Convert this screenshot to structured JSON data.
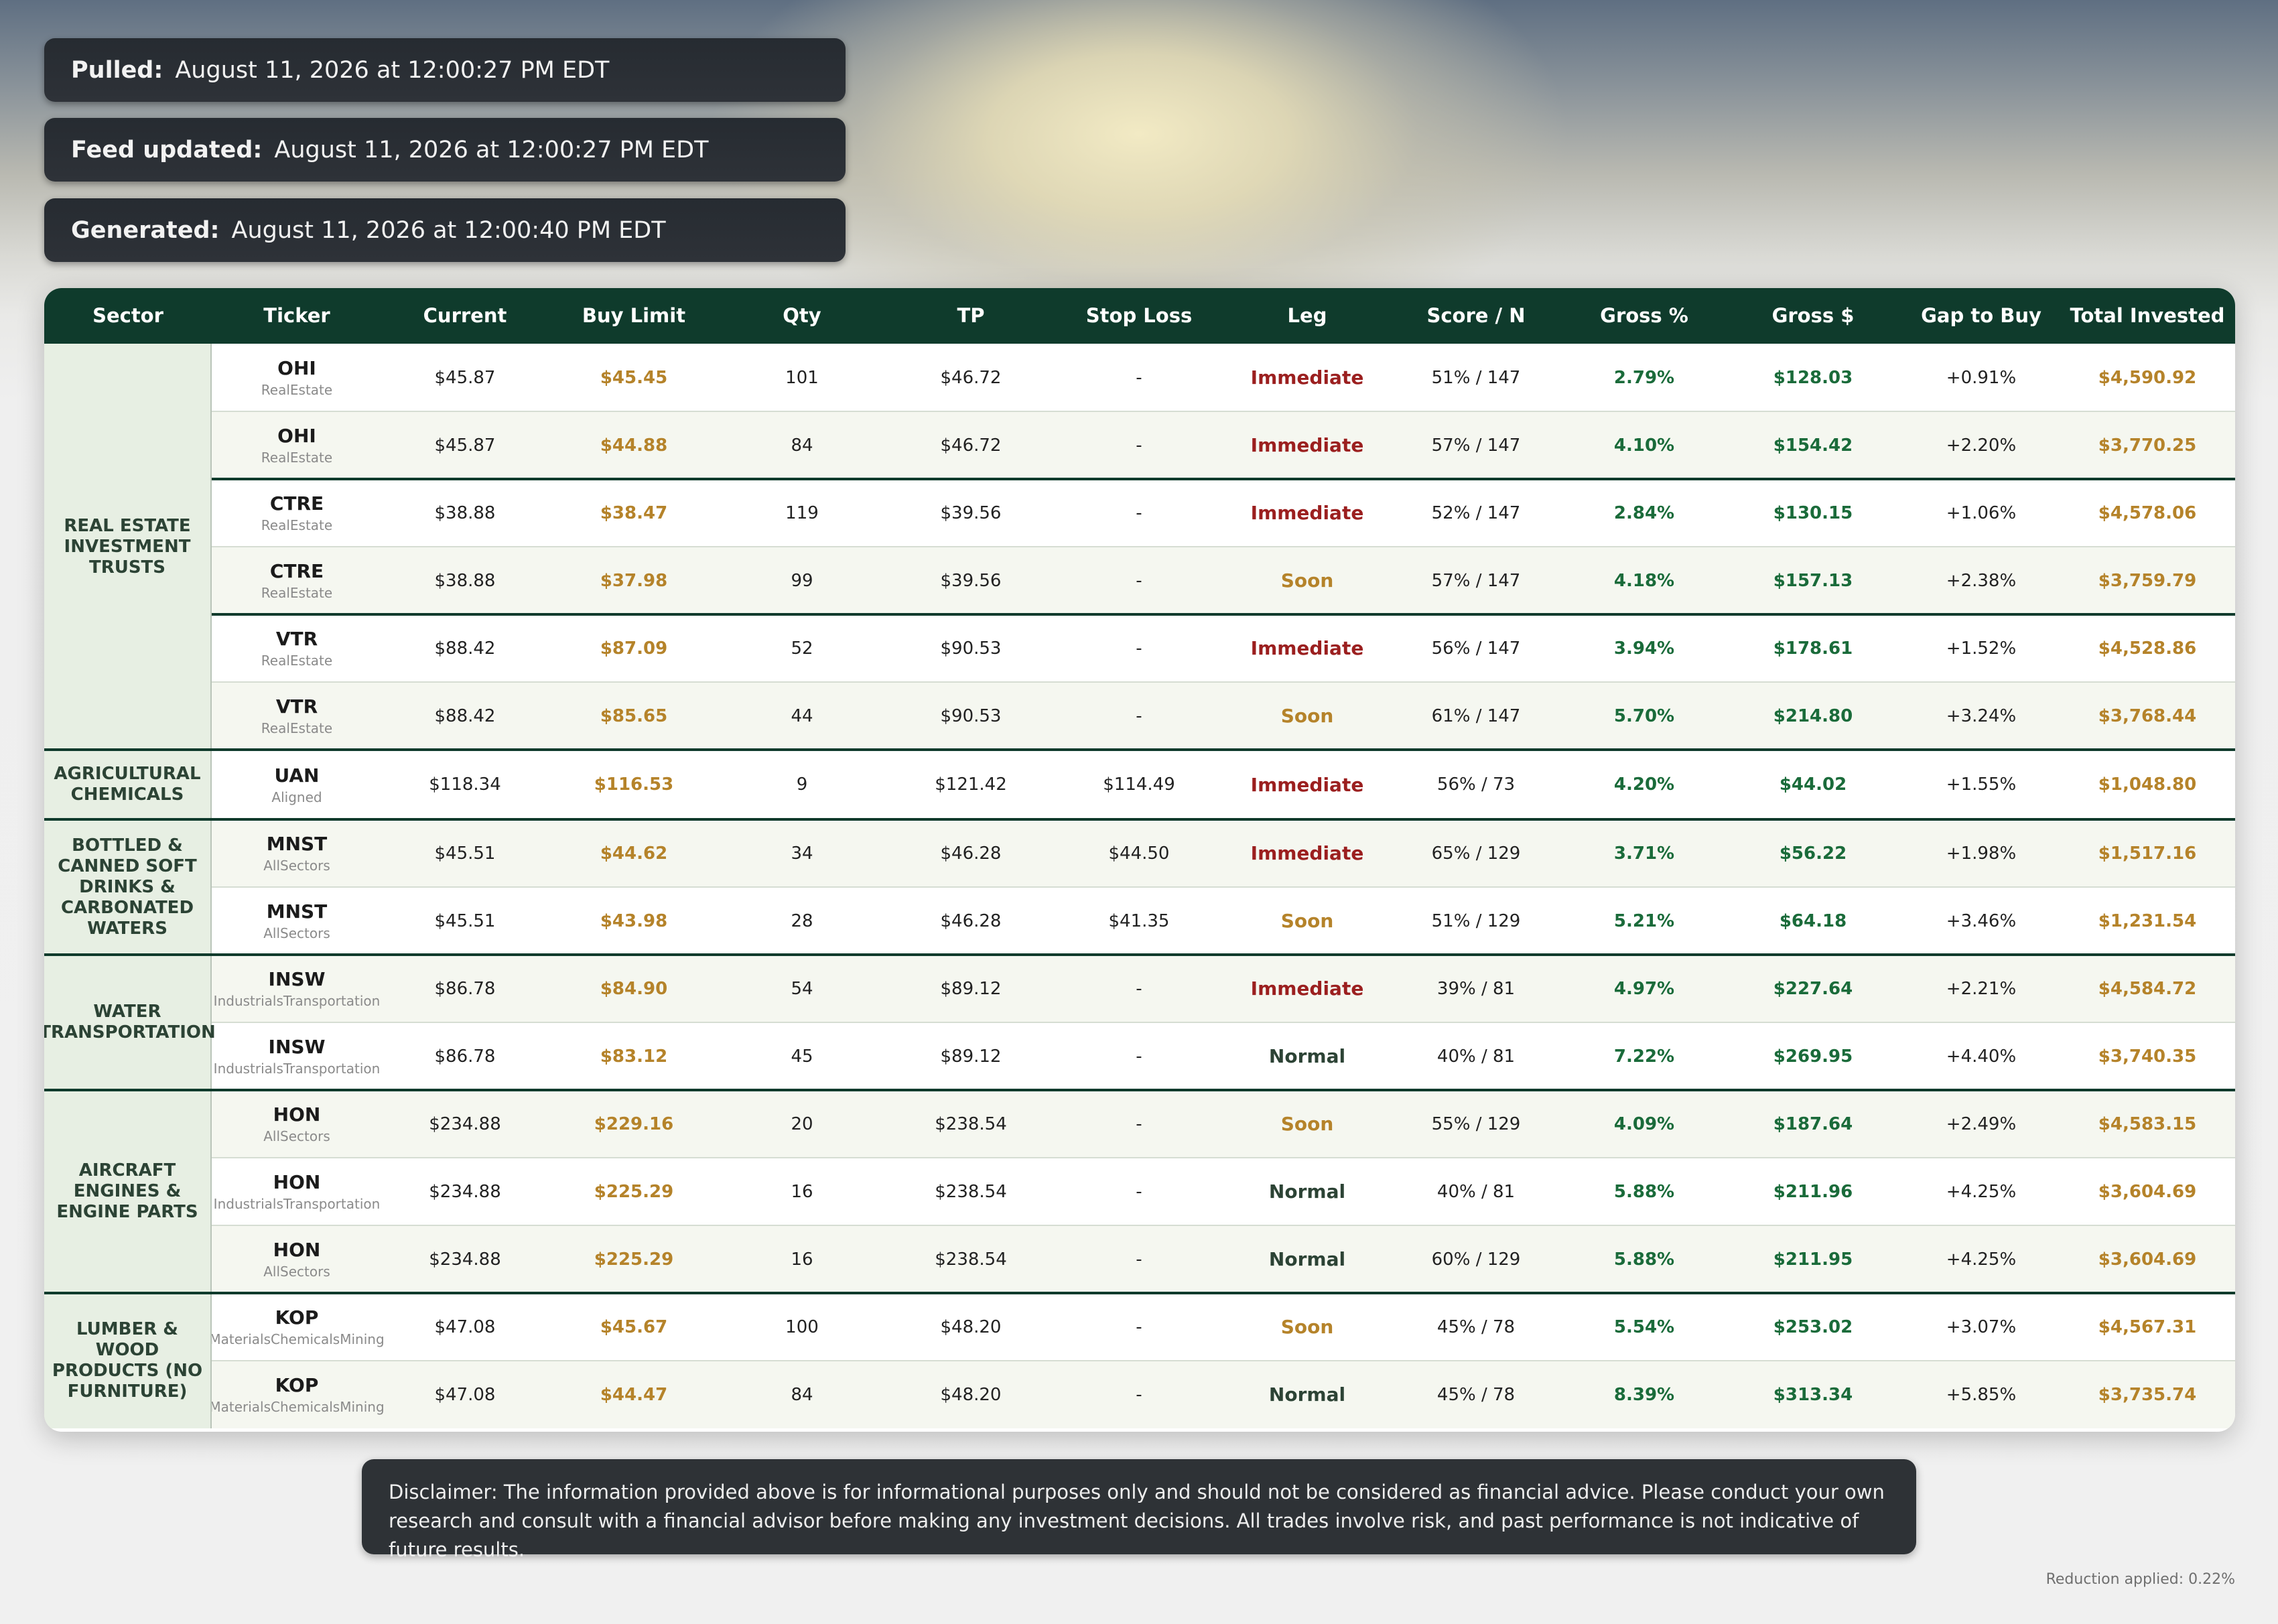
{
  "timestamps": [
    {
      "label": "Pulled:",
      "value": "August 11, 2026 at 12:00:27 PM EDT"
    },
    {
      "label": "Feed updated:",
      "value": "August 11, 2026 at 12:00:27 PM EDT"
    },
    {
      "label": "Generated:",
      "value": "August 11, 2026 at 12:00:40 PM EDT"
    }
  ],
  "table": {
    "headers": [
      "Sector",
      "Ticker",
      "Current",
      "Buy Limit",
      "Qty",
      "TP",
      "Stop Loss",
      "Leg",
      "Score / N",
      "Gross %",
      "Gross $",
      "Gap to Buy",
      "Total Invested"
    ],
    "sectors": [
      {
        "name": "REAL ESTATE INVESTMENT TRUSTS",
        "display": "REAL ESTATE\nINVESTMENT\nTRUSTS",
        "rows": 6
      },
      {
        "name": "AGRICULTURAL CHEMICALS",
        "display": "AGRICULTURAL\nCHEMICALS",
        "rows": 1
      },
      {
        "name": "BOTTLED & CANNED SOFT DRINKS & CARBONATED WATERS",
        "display": "BOTTLED &\nCANNED SOFT\nDRINKS &\nCARBONATED\nWATERS",
        "rows": 2
      },
      {
        "name": "WATER TRANSPORTATION",
        "display": "WATER\nTRANSPORTATION",
        "rows": 2
      },
      {
        "name": "AIRCRAFT ENGINES & ENGINE PARTS",
        "display": "AIRCRAFT\nENGINES &\nENGINE PARTS",
        "rows": 3
      },
      {
        "name": "LUMBER & WOOD PRODUCTS (NO FURNITURE)",
        "display": "LUMBER &\nWOOD\nPRODUCTS (NO\nFURNITURE)",
        "rows": 2
      }
    ],
    "rows": [
      {
        "ticker": "OHI",
        "source": "RealEstate",
        "current": "$45.87",
        "buy_limit": "$45.45",
        "qty": "101",
        "tp": "$46.72",
        "stop_loss": "-",
        "leg": "Immediate",
        "score": "51% / 147",
        "gross_pct": "2.79%",
        "gross_usd": "$128.03",
        "gap": "+0.91%",
        "total": "$4,590.92"
      },
      {
        "ticker": "OHI",
        "source": "RealEstate",
        "current": "$45.87",
        "buy_limit": "$44.88",
        "qty": "84",
        "tp": "$46.72",
        "stop_loss": "-",
        "leg": "Immediate",
        "score": "57% / 147",
        "gross_pct": "4.10%",
        "gross_usd": "$154.42",
        "gap": "+2.20%",
        "total": "$3,770.25"
      },
      {
        "ticker": "CTRE",
        "source": "RealEstate",
        "current": "$38.88",
        "buy_limit": "$38.47",
        "qty": "119",
        "tp": "$39.56",
        "stop_loss": "-",
        "leg": "Immediate",
        "score": "52% / 147",
        "gross_pct": "2.84%",
        "gross_usd": "$130.15",
        "gap": "+1.06%",
        "total": "$4,578.06"
      },
      {
        "ticker": "CTRE",
        "source": "RealEstate",
        "current": "$38.88",
        "buy_limit": "$37.98",
        "qty": "99",
        "tp": "$39.56",
        "stop_loss": "-",
        "leg": "Soon",
        "score": "57% / 147",
        "gross_pct": "4.18%",
        "gross_usd": "$157.13",
        "gap": "+2.38%",
        "total": "$3,759.79"
      },
      {
        "ticker": "VTR",
        "source": "RealEstate",
        "current": "$88.42",
        "buy_limit": "$87.09",
        "qty": "52",
        "tp": "$90.53",
        "stop_loss": "-",
        "leg": "Immediate",
        "score": "56% / 147",
        "gross_pct": "3.94%",
        "gross_usd": "$178.61",
        "gap": "+1.52%",
        "total": "$4,528.86"
      },
      {
        "ticker": "VTR",
        "source": "RealEstate",
        "current": "$88.42",
        "buy_limit": "$85.65",
        "qty": "44",
        "tp": "$90.53",
        "stop_loss": "-",
        "leg": "Soon",
        "score": "61% / 147",
        "gross_pct": "5.70%",
        "gross_usd": "$214.80",
        "gap": "+3.24%",
        "total": "$3,768.44"
      },
      {
        "ticker": "UAN",
        "source": "Aligned",
        "current": "$118.34",
        "buy_limit": "$116.53",
        "qty": "9",
        "tp": "$121.42",
        "stop_loss": "$114.49",
        "leg": "Immediate",
        "score": "56% / 73",
        "gross_pct": "4.20%",
        "gross_usd": "$44.02",
        "gap": "+1.55%",
        "total": "$1,048.80"
      },
      {
        "ticker": "MNST",
        "source": "AllSectors",
        "current": "$45.51",
        "buy_limit": "$44.62",
        "qty": "34",
        "tp": "$46.28",
        "stop_loss": "$44.50",
        "leg": "Immediate",
        "score": "65% / 129",
        "gross_pct": "3.71%",
        "gross_usd": "$56.22",
        "gap": "+1.98%",
        "total": "$1,517.16"
      },
      {
        "ticker": "MNST",
        "source": "AllSectors",
        "current": "$45.51",
        "buy_limit": "$43.98",
        "qty": "28",
        "tp": "$46.28",
        "stop_loss": "$41.35",
        "leg": "Soon",
        "score": "51% / 129",
        "gross_pct": "5.21%",
        "gross_usd": "$64.18",
        "gap": "+3.46%",
        "total": "$1,231.54"
      },
      {
        "ticker": "INSW",
        "source": "IndustrialsTransportation",
        "current": "$86.78",
        "buy_limit": "$84.90",
        "qty": "54",
        "tp": "$89.12",
        "stop_loss": "-",
        "leg": "Immediate",
        "score": "39% / 81",
        "gross_pct": "4.97%",
        "gross_usd": "$227.64",
        "gap": "+2.21%",
        "total": "$4,584.72"
      },
      {
        "ticker": "INSW",
        "source": "IndustrialsTransportation",
        "current": "$86.78",
        "buy_limit": "$83.12",
        "qty": "45",
        "tp": "$89.12",
        "stop_loss": "-",
        "leg": "Normal",
        "score": "40% / 81",
        "gross_pct": "7.22%",
        "gross_usd": "$269.95",
        "gap": "+4.40%",
        "total": "$3,740.35"
      },
      {
        "ticker": "HON",
        "source": "AllSectors",
        "current": "$234.88",
        "buy_limit": "$229.16",
        "qty": "20",
        "tp": "$238.54",
        "stop_loss": "-",
        "leg": "Soon",
        "score": "55% / 129",
        "gross_pct": "4.09%",
        "gross_usd": "$187.64",
        "gap": "+2.49%",
        "total": "$4,583.15"
      },
      {
        "ticker": "HON",
        "source": "IndustrialsTransportation",
        "current": "$234.88",
        "buy_limit": "$225.29",
        "qty": "16",
        "tp": "$238.54",
        "stop_loss": "-",
        "leg": "Normal",
        "score": "40% / 81",
        "gross_pct": "5.88%",
        "gross_usd": "$211.96",
        "gap": "+4.25%",
        "total": "$3,604.69"
      },
      {
        "ticker": "HON",
        "source": "AllSectors",
        "current": "$234.88",
        "buy_limit": "$225.29",
        "qty": "16",
        "tp": "$238.54",
        "stop_loss": "-",
        "leg": "Normal",
        "score": "60% / 129",
        "gross_pct": "5.88%",
        "gross_usd": "$211.95",
        "gap": "+4.25%",
        "total": "$3,604.69"
      },
      {
        "ticker": "KOP",
        "source": "MaterialsChemicalsMining",
        "current": "$47.08",
        "buy_limit": "$45.67",
        "qty": "100",
        "tp": "$48.20",
        "stop_loss": "-",
        "leg": "Soon",
        "score": "45% / 78",
        "gross_pct": "5.54%",
        "gross_usd": "$253.02",
        "gap": "+3.07%",
        "total": "$4,567.31"
      },
      {
        "ticker": "KOP",
        "source": "MaterialsChemicalsMining",
        "current": "$47.08",
        "buy_limit": "$44.47",
        "qty": "84",
        "tp": "$48.20",
        "stop_loss": "-",
        "leg": "Normal",
        "score": "45% / 78",
        "gross_pct": "8.39%",
        "gross_usd": "$313.34",
        "gap": "+5.85%",
        "total": "$3,735.74"
      }
    ]
  },
  "disclaimer": "Disclaimer: The information provided above is for informational purposes only and should not be considered as financial advice. Please conduct your own research and consult with a financial advisor before making any investment decisions. All trades involve risk, and past performance is not indicative of future results.",
  "reduction": "Reduction applied: 0.22%",
  "colors": {
    "header_bg": "#0f3b2c",
    "gold": "#b5832a",
    "green": "#1a6b3a",
    "immediate": "#9b1f1f",
    "sector_bg": "#e7efe3"
  }
}
